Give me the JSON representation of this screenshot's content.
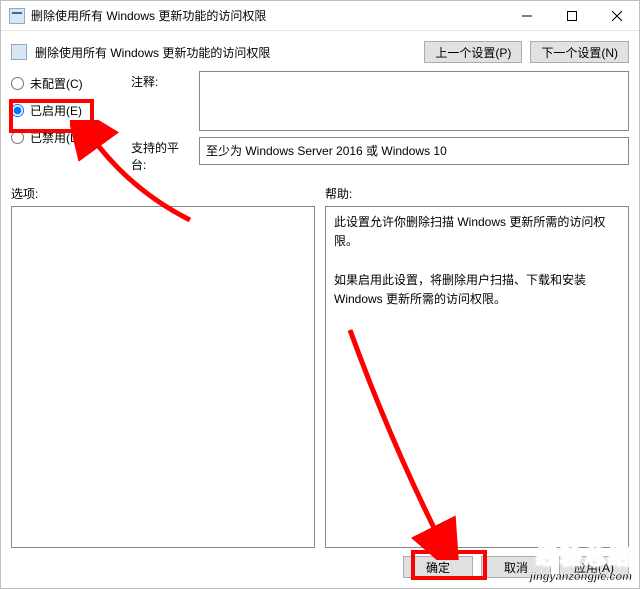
{
  "titlebar": {
    "title": "删除使用所有 Windows 更新功能的访问权限"
  },
  "header": {
    "title": "删除使用所有 Windows 更新功能的访问权限",
    "prev_label": "上一个设置(P)",
    "next_label": "下一个设置(N)"
  },
  "radios": {
    "not_configured": "未配置(C)",
    "enabled": "已启用(E)",
    "disabled": "已禁用(D)",
    "selected": "enabled"
  },
  "fields": {
    "comments_label": "注释:",
    "platform_label": "支持的平台:",
    "platform_text": "至少为 Windows Server 2016 或 Windows 10"
  },
  "columns": {
    "options_label": "选项:",
    "help_label": "帮助:",
    "help_text_p1": "此设置允许你删除扫描 Windows 更新所需的访问权限。",
    "help_text_p2": "如果启用此设置，将删除用户扫描、下载和安装 Windows 更新所需的访问权限。"
  },
  "footer": {
    "ok": "确定",
    "cancel": "取消",
    "apply": "应用(A)"
  },
  "watermark": {
    "line1": "经验总结",
    "line2": "jingyanzongjie.com"
  }
}
